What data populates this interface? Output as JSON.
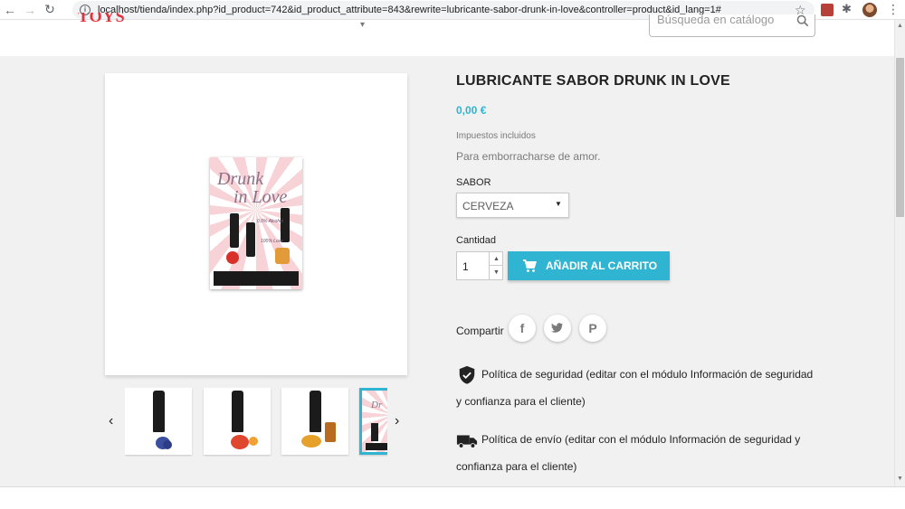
{
  "browser": {
    "back": "←",
    "forward": "→",
    "reload": "↻",
    "url": "localhost/tienda/index.php?id_product=742&id_product_attribute=843&rewrite=lubricante-sabor-drunk-in-love&controller=product&id_lang=1#"
  },
  "header": {
    "search_placeholder": "Búsqueda en catálogo"
  },
  "product": {
    "name": "LUBRICANTE SABOR DRUNK IN LOVE",
    "price": "0,00 €",
    "tax_note": "Impuestos incluidos",
    "short_description": "Para emborracharse de amor.",
    "variant_label": "SABOR",
    "variant_value": "CERVEZA",
    "quantity_label": "Cantidad",
    "quantity_value": "1",
    "add_to_cart_label": "AÑADIR AL CARRITO",
    "share_label": "Compartir",
    "poster": {
      "title_line1": "Drunk",
      "title_line2": "in Love",
      "badge1": "0,0% Alcohol",
      "badge2": "100% Love"
    }
  },
  "reassurance": [
    {
      "icon": "shield-check-icon",
      "text": "Política de seguridad (editar con el módulo Información de seguridad y confianza para el cliente)"
    },
    {
      "icon": "truck-icon",
      "text": "Política de envío (editar con el módulo Información de seguridad y confianza para el cliente)"
    }
  ],
  "colors": {
    "accent": "#2fb5d2",
    "background": "#f1f1f1",
    "logo": "#e4303b"
  },
  "thumbnails": [
    {
      "fruit": "blueberry",
      "color": "#3b4f9e"
    },
    {
      "fruit": "strawberry",
      "color": "#e0472f"
    },
    {
      "fruit": "lemon",
      "color": "#e6a12a"
    },
    {
      "fruit": "poster",
      "color": "#f7d2d6"
    }
  ]
}
